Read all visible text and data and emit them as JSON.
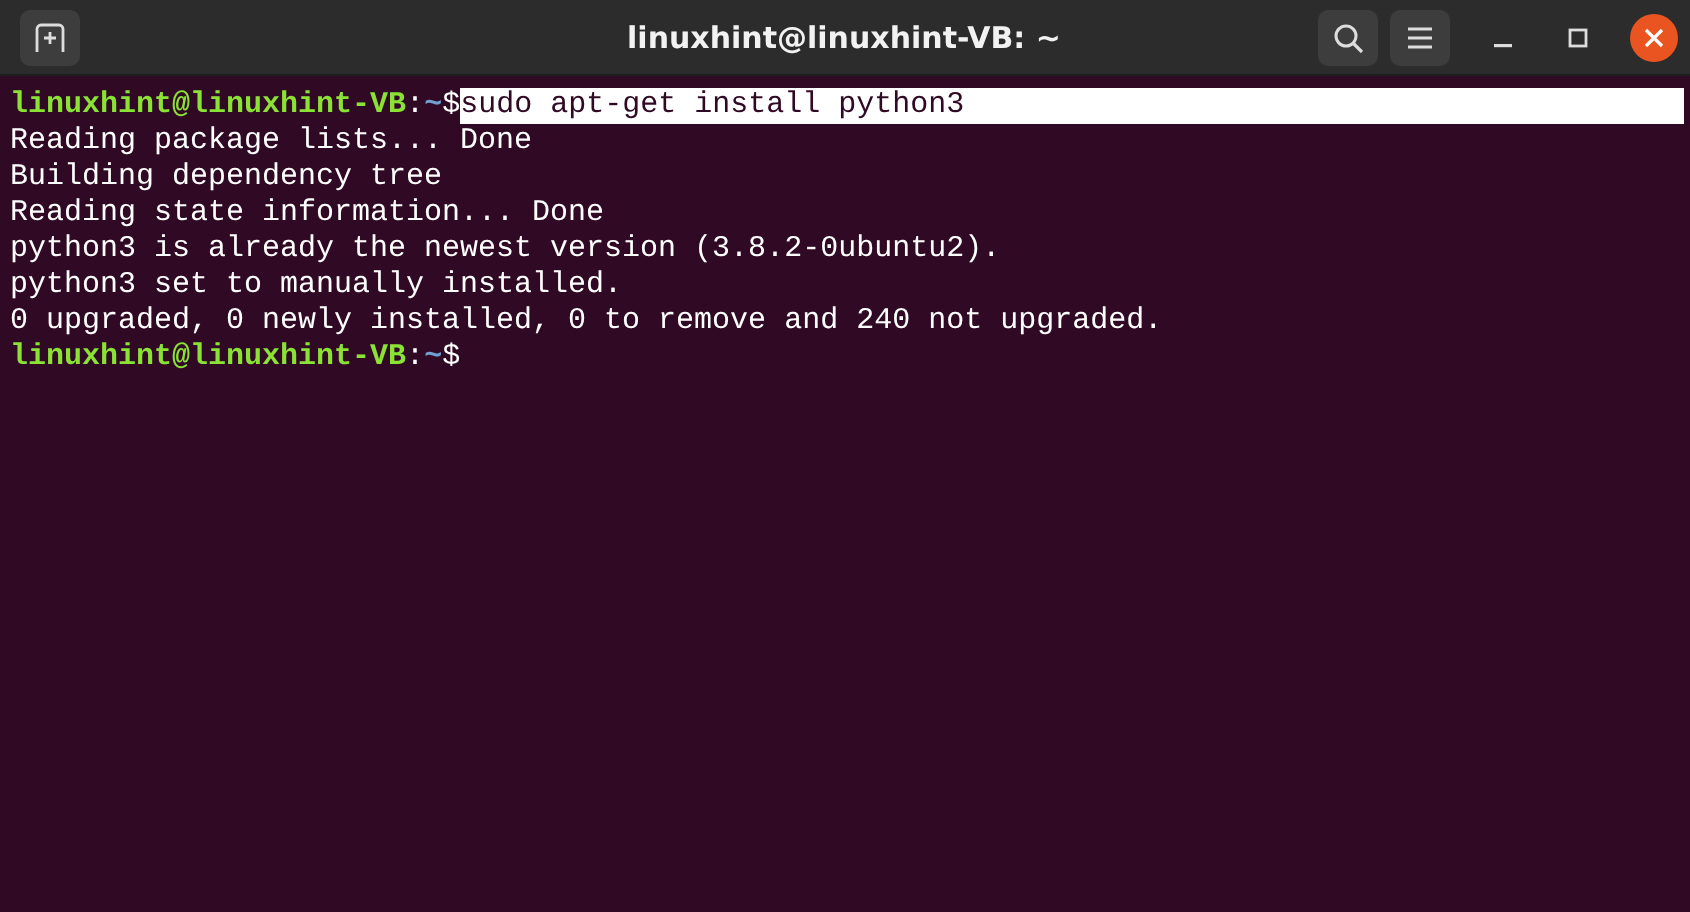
{
  "window": {
    "title": "linuxhint@linuxhint-VB: ~"
  },
  "lines": [
    {
      "kind": "prompt",
      "user_host": "linuxhint@linuxhint-VB",
      "separator": ":",
      "path": "~",
      "symbol": "$",
      "command": "sudo apt-get install python3",
      "highlighted": true
    },
    {
      "kind": "output",
      "text": "Reading package lists... Done"
    },
    {
      "kind": "output",
      "text": "Building dependency tree"
    },
    {
      "kind": "output",
      "text": "Reading state information... Done"
    },
    {
      "kind": "output",
      "text": "python3 is already the newest version (3.8.2-0ubuntu2)."
    },
    {
      "kind": "output",
      "text": "python3 set to manually installed."
    },
    {
      "kind": "output",
      "text": "0 upgraded, 0 newly installed, 0 to remove and 240 not upgraded."
    },
    {
      "kind": "prompt",
      "user_host": "linuxhint@linuxhint-VB",
      "separator": ":",
      "path": "~",
      "symbol": "$"
    }
  ]
}
